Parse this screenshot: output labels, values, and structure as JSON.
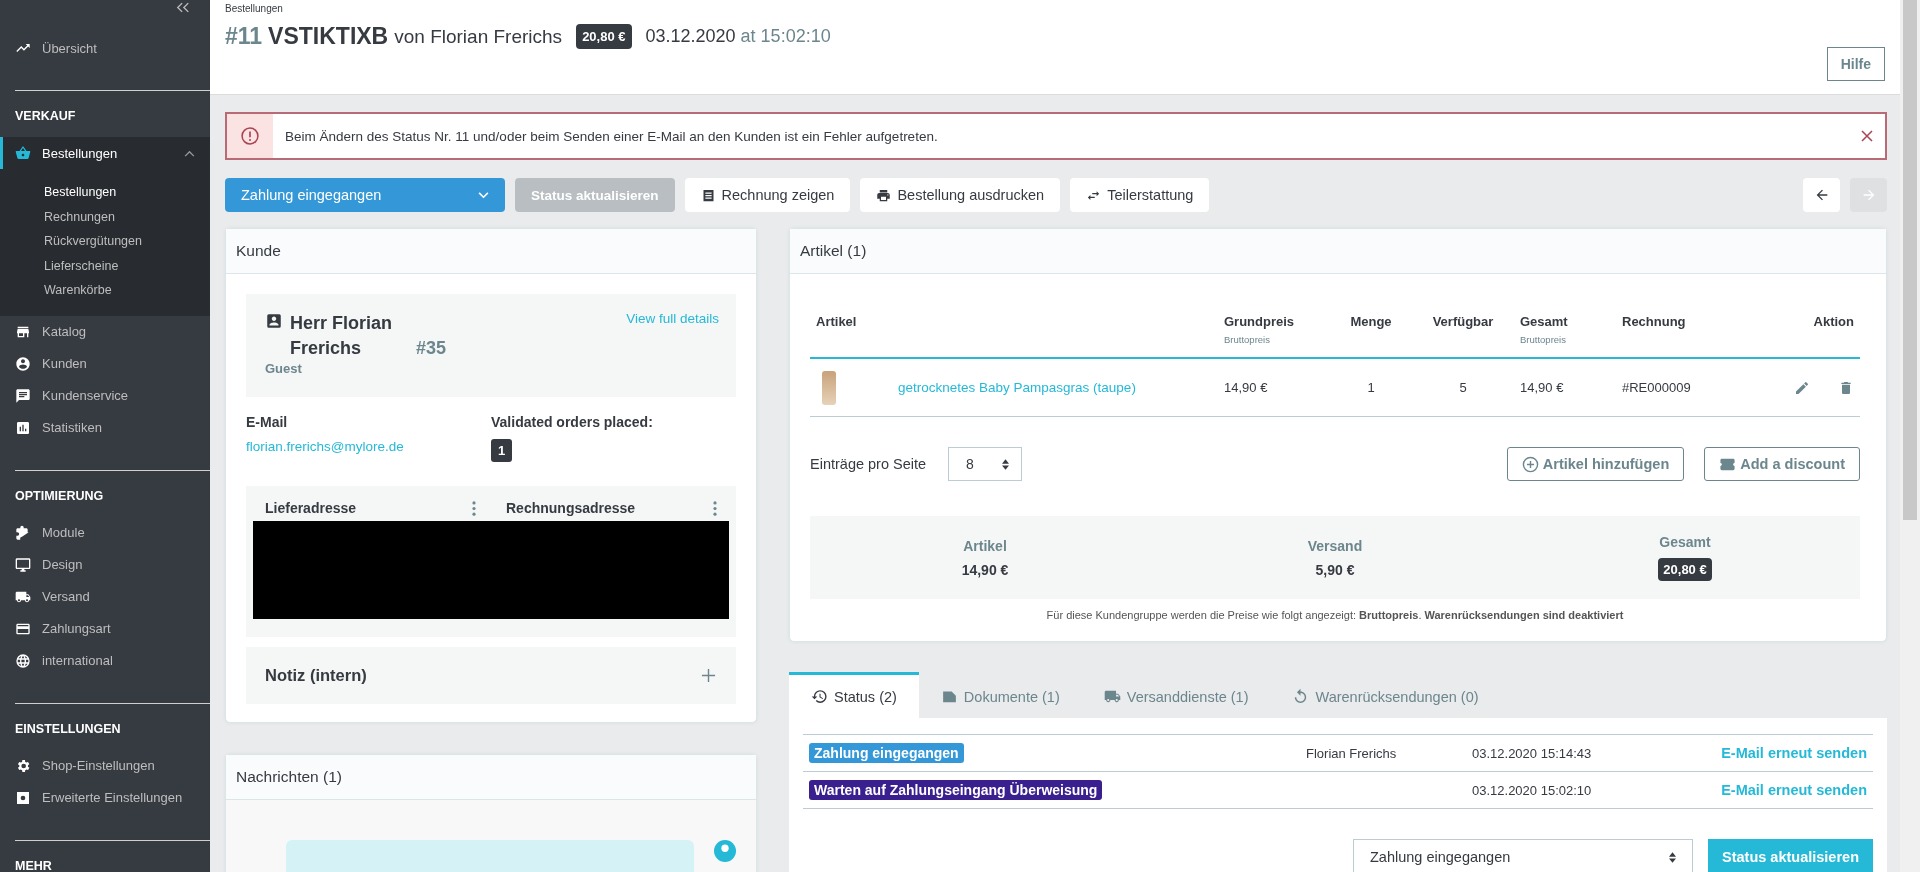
{
  "sidebar": {
    "sections": [
      {
        "items": [
          {
            "label": "Übersicht",
            "selected": false
          }
        ]
      },
      {
        "title": "VERKAUF",
        "items": [
          {
            "label": "Bestellungen",
            "selected": true,
            "expanded": true,
            "children": [
              {
                "label": "Bestellungen",
                "selected": true
              },
              {
                "label": "Rechnungen",
                "selected": false
              },
              {
                "label": "Rückvergütungen",
                "selected": false
              },
              {
                "label": "Lieferscheine",
                "selected": false
              },
              {
                "label": "Warenkörbe",
                "selected": false
              }
            ]
          },
          {
            "label": "Katalog",
            "selected": false
          },
          {
            "label": "Kunden",
            "selected": false
          },
          {
            "label": "Kundenservice",
            "selected": false
          },
          {
            "label": "Statistiken",
            "selected": false
          }
        ]
      },
      {
        "title": "OPTIMIERUNG",
        "items": [
          {
            "label": "Module",
            "selected": false
          },
          {
            "label": "Design",
            "selected": false
          },
          {
            "label": "Versand",
            "selected": false
          },
          {
            "label": "Zahlungsart",
            "selected": false
          },
          {
            "label": "international",
            "selected": false
          }
        ]
      },
      {
        "title": "EINSTELLUNGEN",
        "items": [
          {
            "label": "Shop-Einstellungen",
            "selected": false
          },
          {
            "label": "Erweiterte Einstellungen",
            "selected": false
          }
        ]
      },
      {
        "title": "MEHR"
      }
    ]
  },
  "header": {
    "breadcrumb": "Bestellungen",
    "order_number": "#11",
    "reference": "VSTIKTIXB",
    "customer": "von Florian Frerichs",
    "total": "20,80 €",
    "date": "03.12.2020",
    "time": "at 15:02:10",
    "help_button": "Hilfe"
  },
  "alert": {
    "message": "Beim Ändern des Status Nr. 11 und/oder beim Senden einer E-Mail an den Kunden ist ein Fehler aufgetreten."
  },
  "toolbar": {
    "actions": [
      {
        "kind": "select",
        "label": "Zahlung eingegangen"
      },
      {
        "kind": "button",
        "label": "Status aktualisieren",
        "disabled": true
      },
      {
        "kind": "button",
        "label": "Rechnung zeigen",
        "disabled": false
      },
      {
        "kind": "button",
        "label": "Bestellung ausdrucken",
        "disabled": false
      },
      {
        "kind": "button",
        "label": "Teilerstattung",
        "disabled": false
      }
    ],
    "nav": [
      {
        "kind": "previous",
        "disabled": false
      },
      {
        "kind": "next",
        "disabled": true
      }
    ]
  },
  "customer": {
    "title": "Kunde",
    "name": "Herr Florian Frerichs",
    "number": "#35",
    "group": "Guest",
    "details_link": "View full details",
    "email_label": "E-Mail",
    "email": "florian.frerichs@mylore.de",
    "orders_label": "Validated orders placed:",
    "orders_count": "1",
    "shipping_label": "Lieferadresse",
    "billing_label": "Rechnungsadresse",
    "note_title": "Notiz (intern)"
  },
  "messages": {
    "title": "Nachrichten (1)"
  },
  "articles": {
    "title": "Artikel (1)",
    "columns": [
      {
        "label": "Artikel"
      },
      {},
      {
        "label": "Grundpreis",
        "sub": "Bruttopreis"
      },
      {
        "label": "Menge"
      },
      {
        "label": "Verfügbar"
      },
      {
        "label": "Gesamt",
        "sub": "Bruttopreis"
      },
      {
        "label": "Rechnung"
      },
      {
        "label": "Aktion"
      }
    ],
    "rows": [
      {
        "name": "getrocknetes Baby Pampasgras (taupe)",
        "unit_price": "14,90 €",
        "quantity": "1",
        "available": "5",
        "total": "14,90 €",
        "invoice": "#RE000009"
      }
    ],
    "per_page_label": "Einträge pro Seite",
    "per_page": "8",
    "add_button": "Artikel hinzufügen",
    "discount_button": "Add a discount",
    "summary": [
      {
        "label": "Artikel",
        "value": "14,90 €",
        "highlight": false
      },
      {
        "label": "Versand",
        "value": "5,90 €",
        "highlight": false
      },
      {
        "label": "Gesamt",
        "value": "20,80 €",
        "highlight": true
      }
    ],
    "note": "Für diese Kundengruppe werden die Preise wie folgt angezeigt: **Bruttopreis**. **Warenrücksendungen sind deaktiviert**"
  },
  "status_panel": {
    "tabs": [
      {
        "label": "Status (2)",
        "selected": true
      },
      {
        "label": "Dokumente (1)",
        "selected": false
      },
      {
        "label": "Versanddienste (1)",
        "selected": false
      },
      {
        "label": "Warenrücksendungen (0)",
        "selected": false
      }
    ],
    "rows": [
      {
        "status": "Zahlung eingegangen",
        "color": "#3498d8",
        "employee": "Florian Frerichs",
        "date": "03.12.2020 15:14:43",
        "action": "E-Mail erneut senden"
      },
      {
        "status": "Warten auf Zahlungseingang Überweisung",
        "color": "#3a1f8f",
        "date": "03.12.2020 15:02:10",
        "action": "E-Mail erneut senden"
      }
    ],
    "select": "Zahlung eingegangen",
    "update_button": "Status aktualisieren"
  }
}
